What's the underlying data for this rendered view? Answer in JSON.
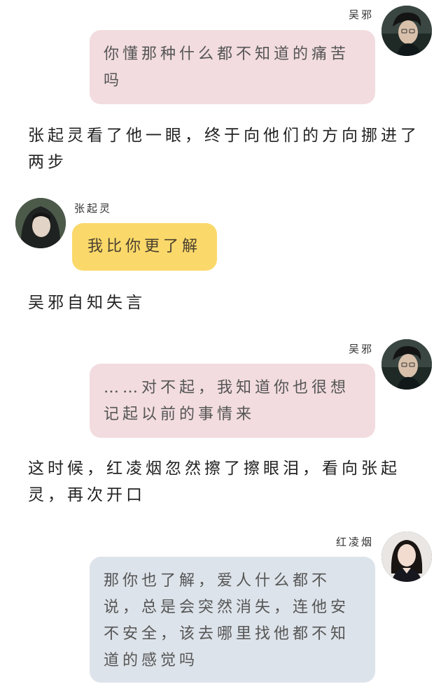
{
  "messages": [
    {
      "speaker": "吴邪",
      "text": "你懂那种什么都不知道的痛苦吗"
    },
    {
      "narration": "张起灵看了他一眼，终于向他们的方向挪进了两步"
    },
    {
      "speaker": "张起灵",
      "text": "我比你更了解"
    },
    {
      "narration": "吴邪自知失言"
    },
    {
      "speaker": "吴邪",
      "text": "……对不起，我知道你也很想记起以前的事情来"
    },
    {
      "narration": "这时候，红凌烟忽然擦了擦眼泪，看向张起灵，再次开口"
    },
    {
      "speaker": "红凌烟",
      "text": "那你也了解，爱人什么都不说，总是会突然消失，连他安不安全，该去哪里找他都不知道的感觉吗"
    }
  ],
  "colors": {
    "bubble_pink": "#f2dcdf",
    "bubble_yellow": "#fad96a",
    "bubble_gray": "#dde3ea"
  },
  "icons": {
    "wu_xie": "avatar-photo",
    "zhang_qiling": "avatar-photo",
    "hong_lingyan": "avatar-photo"
  }
}
